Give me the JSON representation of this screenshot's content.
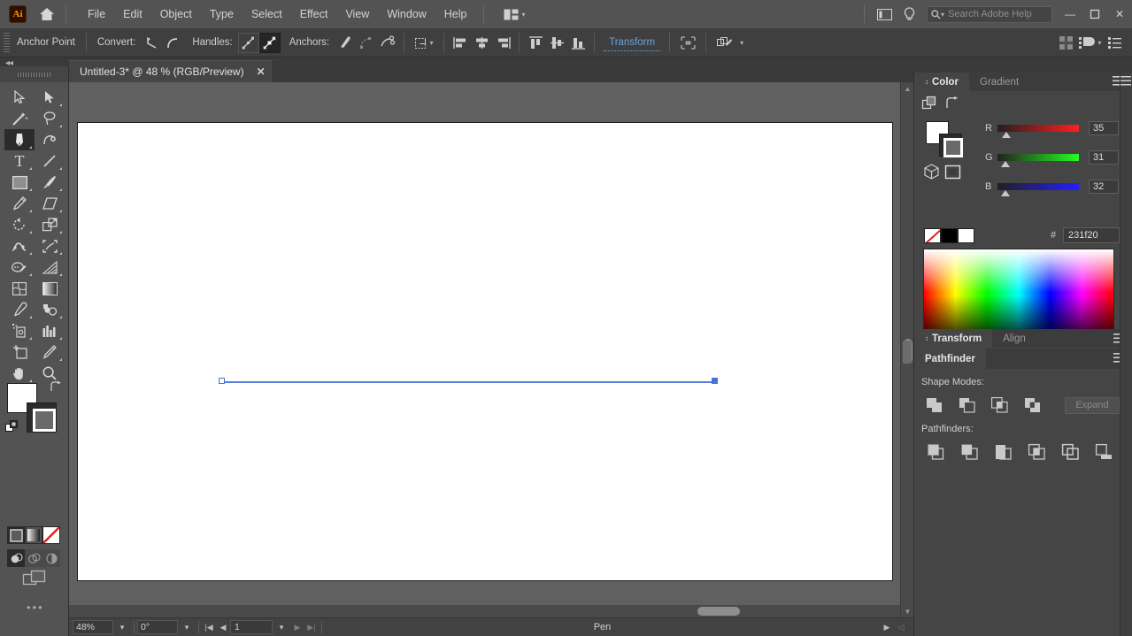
{
  "app": {
    "name": "Adobe Illustrator",
    "logo_text": "Ai",
    "home_icon": "home-icon"
  },
  "menubar": {
    "items": [
      {
        "label": "File"
      },
      {
        "label": "Edit"
      },
      {
        "label": "Object"
      },
      {
        "label": "Type"
      },
      {
        "label": "Select"
      },
      {
        "label": "Effect"
      },
      {
        "label": "View"
      },
      {
        "label": "Window"
      },
      {
        "label": "Help"
      }
    ],
    "arrange_documents_icon": "arrange-documents-icon",
    "switch_workspace_icon": "switch-workspace-icon",
    "help_bulb_icon": "lightbulb-icon",
    "search": {
      "placeholder": "Search Adobe Help",
      "value": ""
    },
    "window_controls": {
      "minimize": "—",
      "maximize": "☐",
      "close": "✕"
    }
  },
  "controlbar": {
    "tool_name": "Anchor Point",
    "convert_label": "Convert:",
    "convert_buttons": [
      "convert-to-corner-icon",
      "convert-to-smooth-icon"
    ],
    "handles_label": "Handles:",
    "handles_buttons": [
      "show-handles-icon",
      "hide-handles-icon"
    ],
    "handles_selected_index": 1,
    "anchors_label": "Anchors:",
    "anchors_buttons": [
      "remove-anchor-icon",
      "connect-anchor-icon",
      "cut-path-icon"
    ],
    "isolate_label": "isolate-selected-object-icon",
    "align_objects": [
      "align-left-icon",
      "align-horizontal-center-icon",
      "align-right-icon",
      "align-top-icon",
      "align-vertical-center-icon",
      "align-bottom-icon"
    ],
    "transform_label": "Transform",
    "transform_link_color": "#6aa0dd",
    "align_panel_icon": "align-panel-icon",
    "shape_builder_icon": "shape-builder-icon",
    "right_icons": [
      "arrange-icon",
      "align-to-icon",
      "options-list-icon"
    ]
  },
  "tabs": {
    "collapse_icon": "collapse-panel-icon",
    "documents": [
      {
        "title": "Untitled-3* @ 48 % (RGB/Preview)",
        "close": "✕",
        "active": true
      }
    ]
  },
  "toolbar": {
    "rows": [
      [
        {
          "name": "selection-tool",
          "icon": "arrow-solid-icon"
        },
        {
          "name": "direct-selection-tool",
          "icon": "arrow-outline-icon"
        }
      ],
      [
        {
          "name": "magic-wand-tool",
          "icon": "magic-wand-icon"
        },
        {
          "name": "lasso-tool",
          "icon": "lasso-icon"
        }
      ],
      [
        {
          "name": "pen-tool",
          "icon": "pen-icon",
          "active": true
        },
        {
          "name": "curvature-tool",
          "icon": "curvature-icon"
        }
      ],
      [
        {
          "name": "type-tool",
          "icon": "type-t-icon"
        },
        {
          "name": "line-segment-tool",
          "icon": "line-segment-icon"
        }
      ],
      [
        {
          "name": "rectangle-tool",
          "icon": "rectangle-icon"
        },
        {
          "name": "paintbrush-tool",
          "icon": "paintbrush-icon"
        }
      ],
      [
        {
          "name": "pencil-tool",
          "icon": "pencil-icon"
        },
        {
          "name": "eraser-tool",
          "icon": "eraser-icon"
        }
      ],
      [
        {
          "name": "rotate-tool",
          "icon": "rotate-icon"
        },
        {
          "name": "scale-tool",
          "icon": "scale-icon"
        }
      ],
      [
        {
          "name": "width-tool",
          "icon": "width-warp-icon"
        },
        {
          "name": "free-transform-tool",
          "icon": "free-transform-icon"
        }
      ],
      [
        {
          "name": "shape-builder-tool",
          "icon": "shape-builder-icon"
        },
        {
          "name": "perspective-grid-tool",
          "icon": "perspective-grid-icon"
        }
      ],
      [
        {
          "name": "mesh-tool",
          "icon": "mesh-icon"
        },
        {
          "name": "gradient-tool",
          "icon": "gradient-icon"
        }
      ],
      [
        {
          "name": "eyedropper-tool",
          "icon": "eyedropper-icon"
        },
        {
          "name": "blend-tool",
          "icon": "blend-icon"
        }
      ],
      [
        {
          "name": "symbol-sprayer-tool",
          "icon": "symbol-sprayer-icon"
        },
        {
          "name": "column-graph-tool",
          "icon": "bar-chart-icon"
        }
      ],
      [
        {
          "name": "artboard-tool",
          "icon": "artboard-icon"
        },
        {
          "name": "slice-tool",
          "icon": "slice-knife-icon"
        }
      ],
      [
        {
          "name": "hand-tool",
          "icon": "hand-icon"
        },
        {
          "name": "zoom-tool",
          "icon": "magnifier-icon"
        }
      ]
    ],
    "fill_color": "#ffffff",
    "stroke_color": "#2b2b2b",
    "swap_icon": "swap-fill-stroke-icon",
    "default_icon": "default-fill-stroke-icon",
    "color_modes": [
      "flat-color-icon",
      "gradient-icon",
      "none-icon"
    ],
    "draw_modes": [
      "draw-normal-icon",
      "draw-behind-icon",
      "draw-inside-icon"
    ],
    "draw_mode_selected": 0,
    "screen_mode_icon": "change-screen-mode-icon",
    "more_tools": "•••"
  },
  "canvas": {
    "artboard_background": "#ffffff",
    "path_color": "#5a7fe0",
    "anchors": [
      {
        "type": "open-anchor-point",
        "selected": false
      },
      {
        "type": "filled-anchor-point",
        "selected": true
      }
    ]
  },
  "statusbar": {
    "zoom_level": "48%",
    "rotation": "0°",
    "page_number": "1",
    "current_tool": "Pen",
    "first_icon": "first-artboard-icon",
    "prev_icon": "previous-artboard-icon",
    "next_icon": "next-artboard-icon",
    "last_icon": "last-artboard-icon",
    "play_icon": "status-expand-icon",
    "back_icon": "status-collapse-icon"
  },
  "panels": {
    "color": {
      "tabs": [
        {
          "label": "Color",
          "active": true
        },
        {
          "label": "Gradient",
          "active": false
        }
      ],
      "menu_icon": "panel-menu-icon",
      "swap_icon": "swap-fill-stroke-icon",
      "color_space_icon": "color-cube-icon",
      "out_of_gamut_icon": "out-of-web-gamut-icon",
      "sliders": [
        {
          "label": "R",
          "value": "35",
          "max": 255,
          "color": "#ff0000"
        },
        {
          "label": "G",
          "value": "31",
          "max": 255,
          "color": "#00ff00"
        },
        {
          "label": "B",
          "value": "32",
          "max": 255,
          "color": "#0000ff"
        }
      ],
      "hex_label": "#",
      "hex_value": "231f20",
      "quick_swatches": [
        "none-swatch",
        "black-swatch",
        "white-swatch"
      ],
      "spectrum_name": "color-spectrum-ramp"
    },
    "transform": {
      "tabs": [
        {
          "label": "Transform",
          "active": true
        },
        {
          "label": "Align",
          "active": false
        }
      ],
      "menu_icon": "panel-menu-icon"
    },
    "pathfinder": {
      "tabs": [
        {
          "label": "Pathfinder",
          "active": true
        }
      ],
      "menu_icon": "panel-menu-icon",
      "shape_modes_label": "Shape Modes:",
      "shape_modes": [
        "unite-icon",
        "minus-front-icon",
        "intersect-icon",
        "exclude-icon"
      ],
      "expand_label": "Expand",
      "pathfinders_label": "Pathfinders:",
      "pathfinders": [
        "divide-icon",
        "trim-icon",
        "merge-icon",
        "crop-icon",
        "outline-icon",
        "minus-back-icon"
      ]
    }
  }
}
